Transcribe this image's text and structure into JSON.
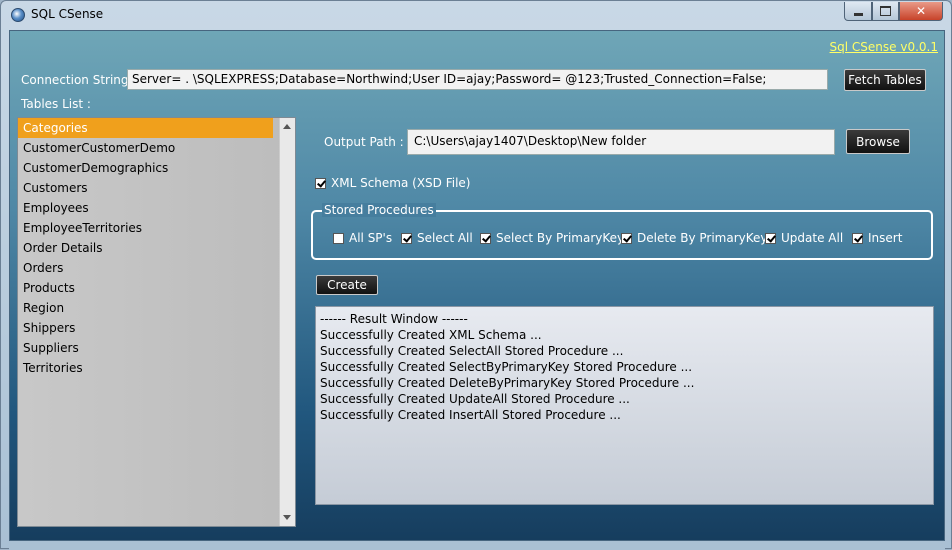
{
  "window": {
    "title": "SQL CSense",
    "version_link": "Sql CSense v0.0.1"
  },
  "connection": {
    "label": "Connection String :",
    "value": "Server=  .  \\SQLEXPRESS;Database=Northwind;User ID=ajay;Password=   @123;Trusted_Connection=False;",
    "fetch_button": "Fetch Tables"
  },
  "tables": {
    "label": "Tables List :",
    "items": [
      "Categories",
      "CustomerCustomerDemo",
      "CustomerDemographics",
      "Customers",
      "Employees",
      "EmployeeTerritories",
      "Order Details",
      "Orders",
      "Products",
      "Region",
      "Shippers",
      "Suppliers",
      "Territories"
    ],
    "selected": "Categories"
  },
  "output": {
    "label": "Output Path :",
    "value": "C:\\Users\\ajay1407\\Desktop\\New folder",
    "browse_button": "Browse"
  },
  "xml_schema": {
    "label": "XML Schema (XSD File)",
    "checked": true
  },
  "stored_procedures": {
    "legend": "Stored Procedures",
    "options": [
      {
        "label": "All SP's",
        "checked": false
      },
      {
        "label": "Select All",
        "checked": true
      },
      {
        "label": "Select By PrimaryKey",
        "checked": true
      },
      {
        "label": "Delete By PrimaryKey",
        "checked": true
      },
      {
        "label": "Update All",
        "checked": true
      },
      {
        "label": "Insert",
        "checked": true
      }
    ]
  },
  "create_button": "Create",
  "result_window": {
    "lines": [
      "------ Result Window ------",
      "Successfully Created XML Schema ...",
      "Successfully Created SelectAll Stored Procedure ...",
      "Successfully Created SelectByPrimaryKey Stored Procedure ...",
      "Successfully Created DeleteByPrimaryKey Stored Procedure ...",
      "Successfully Created UpdateAll Stored Procedure ...",
      "Successfully Created InsertAll Stored Procedure ..."
    ]
  },
  "colors": {
    "selected_item": "#f0a01c",
    "version_link": "#ffff66"
  }
}
